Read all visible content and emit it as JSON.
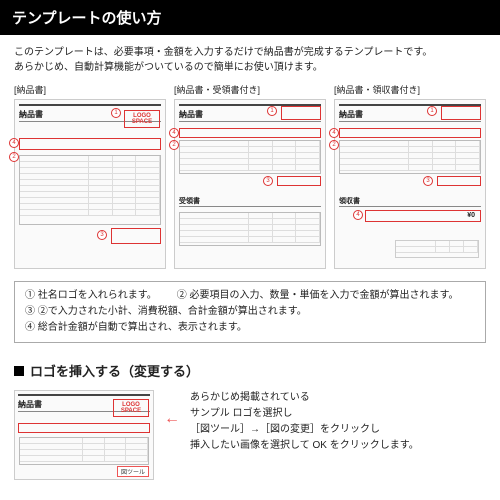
{
  "header": {
    "title": "テンプレートの使い方"
  },
  "description": {
    "line1": "このテンプレートは、必要事項・金額を入力するだけで納品書が完成するテンプレートです。",
    "line2": "あらかじめ、自動計算機能がついているので簡単にお使い頂けます。"
  },
  "thumbs": [
    {
      "label": "[納品書]",
      "title": "納品書"
    },
    {
      "label": "[納品書・受領書付き]",
      "title": "納品書",
      "sub": "受領書"
    },
    {
      "label": "[納品書・領収書付き]",
      "title": "納品書",
      "sub": "領収書",
      "yen": "¥0"
    }
  ],
  "logo_text": "LOGO SPACE",
  "markers": {
    "m1": "1",
    "m2": "2",
    "m3": "3",
    "m4": "4"
  },
  "notes": {
    "n1": "① 社名ロゴを入れられます。",
    "n2": "② 必要項目の入力、数量・単価を入力で金額が算出されます。",
    "n3": "③ ②で入力された小計、消費税額、合計金額が算出されます。",
    "n4": "④ 総合計金額が自動で算出され、表示されます。"
  },
  "section2": {
    "title": "ロゴを挿入する（変更する）"
  },
  "lower": {
    "line1": "あらかじめ掲載されている",
    "line2": "サンプル ロゴを選択し",
    "line3": "［図ツール］→［図の変更］をクリックし",
    "line4": "挿入したい画像を選択して OK をクリックします。",
    "thumb_title": "納品書",
    "tool_btn": "図ツール"
  }
}
